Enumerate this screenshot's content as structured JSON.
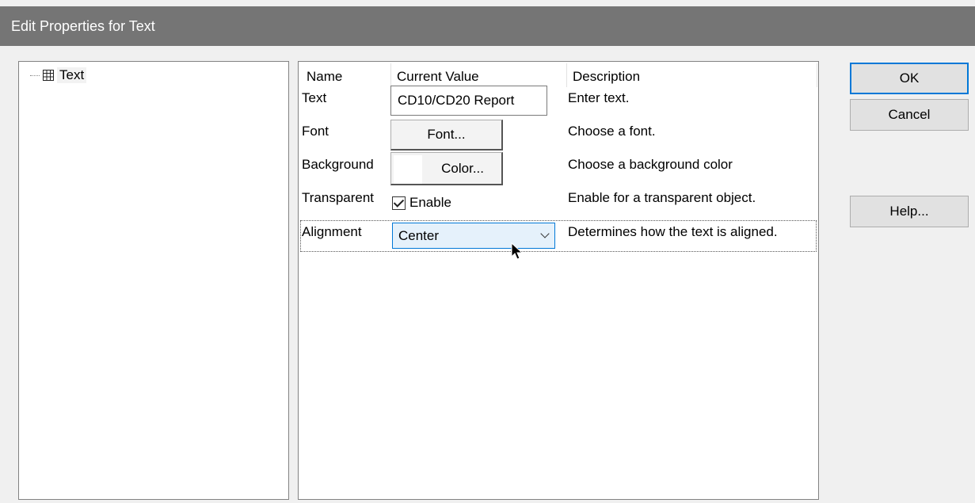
{
  "window": {
    "title": "Edit Properties for Text"
  },
  "tree": {
    "items": [
      {
        "label": "Text",
        "icon": "table-icon"
      }
    ]
  },
  "grid": {
    "headers": {
      "name": "Name",
      "value": "Current Value",
      "description": "Description"
    },
    "rows": {
      "text": {
        "name": "Text",
        "value": "CD10/CD20 Report",
        "description": "Enter text."
      },
      "font": {
        "name": "Font",
        "button": "Font...",
        "description": "Choose a font."
      },
      "background": {
        "name": "Background",
        "button": "Color...",
        "swatch_color": "#ffffff",
        "description": "Choose a background color"
      },
      "transparent": {
        "name": "Transparent",
        "checkbox_label": "Enable",
        "checked": true,
        "description": "Enable for a transparent object."
      },
      "alignment": {
        "name": "Alignment",
        "value": "Center",
        "description": "Determines how the text is aligned."
      }
    }
  },
  "buttons": {
    "ok": "OK",
    "cancel": "Cancel",
    "help": "Help..."
  },
  "colors": {
    "titlebar": "#757575",
    "accent": "#0078d7",
    "combo_bg": "#e5f1fb"
  }
}
